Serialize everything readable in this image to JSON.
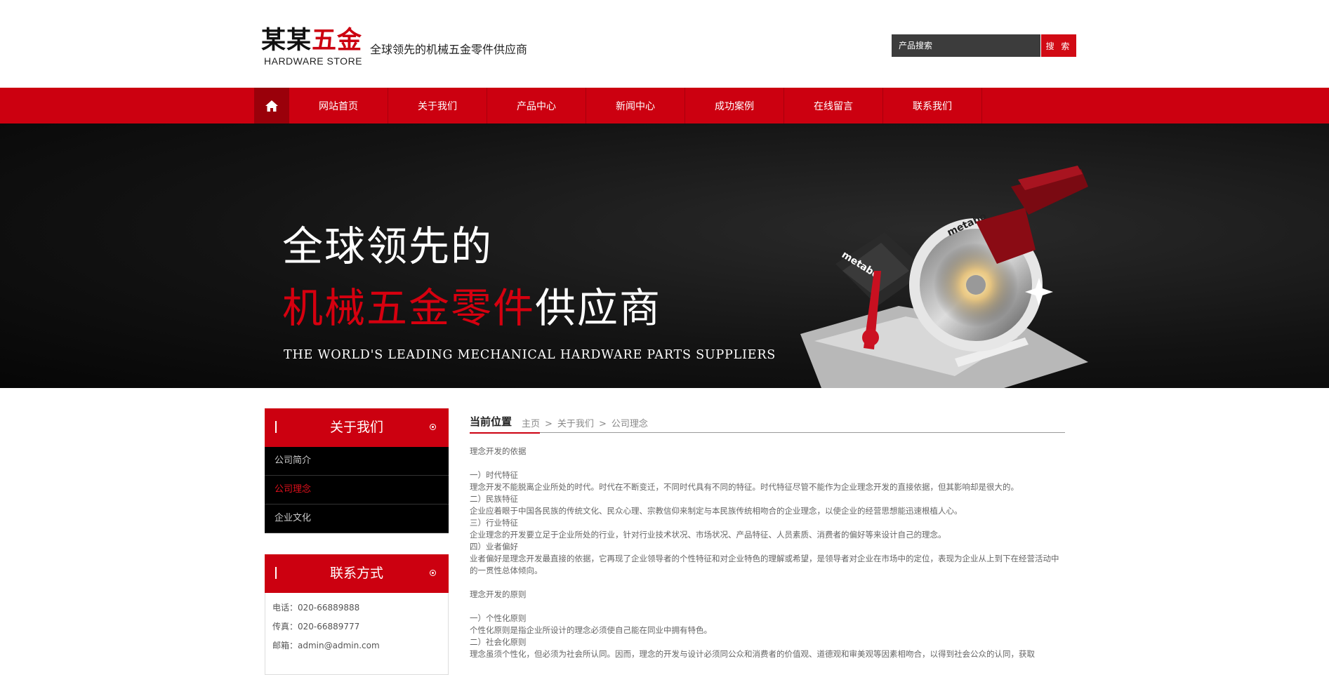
{
  "header": {
    "logo_cn_black": "某某",
    "logo_cn_red": "五金",
    "logo_en": "HARDWARE STORE",
    "slogan": "全球领先的机械五金零件供应商",
    "search_placeholder": "产品搜索",
    "search_button": "搜 索"
  },
  "nav": {
    "home_icon": "home-icon",
    "items": [
      "网站首页",
      "关于我们",
      "产品中心",
      "新闻中心",
      "成功案例",
      "在线留言",
      "联系我们"
    ]
  },
  "banner": {
    "line1": "全球领先的",
    "line2_red": "机械五金零件",
    "line2_white": "供应商",
    "line3": "THE WORLD'S LEADING MECHANICAL HARDWARE PARTS SUPPLIERS",
    "product_brand": "metabo"
  },
  "sidebar": {
    "about_title": "关于我们",
    "about_items": [
      "公司简介",
      "公司理念",
      "企业文化"
    ],
    "active_index": 1,
    "contact_title": "联系方式",
    "contact_lines": [
      "电话：020-66889888",
      "传真：020-66889777",
      "邮箱：admin@admin.com"
    ]
  },
  "breadcrumb": {
    "label": "当前位置",
    "items": [
      "主页",
      "关于我们",
      "公司理念"
    ],
    "separator": ">"
  },
  "article": {
    "paragraphs": [
      "理念开发的依据",
      "",
      "一）时代特征",
      "理念开发不能脱离企业所处的时代。时代在不断变迁，不同时代具有不同的特征。时代特征尽管不能作为企业理念开发的直接依据，但其影响却是很大的。",
      "二）民族特征",
      "企业应着眼于中国各民族的传统文化、民众心理、宗教信仰来制定与本民族传统相吻合的企业理念，以使企业的经营思想能迅速根植人心。",
      "三）行业特征",
      "企业理念的开发要立足于企业所处的行业，针对行业技术状况、市场状况、产品特征、人员素质、消费者的偏好等来设计自己的理念。",
      "四）业者偏好",
      "业者偏好是理念开发最直接的依据，它再现了企业领导者的个性特征和对企业特色的理解或希望，是领导者对企业在市场中的定位，表现为企业从上到下在经营活动中的一贯性总体倾向。",
      "",
      "理念开发的原则",
      "",
      "一）个性化原则",
      "个性化原则是指企业所设计的理念必须使自己能在同业中拥有特色。",
      "二）社会化原则",
      "理念虽须个性化，但必须为社会所认同。因而，理念的开发与设计必须同公众和消费者的价值观、道德观和审美观等因素相吻合，以得到社会公众的认同，获取"
    ]
  },
  "colors": {
    "brand_red": "#cc0010",
    "dark_grey": "#3c3c3c"
  }
}
